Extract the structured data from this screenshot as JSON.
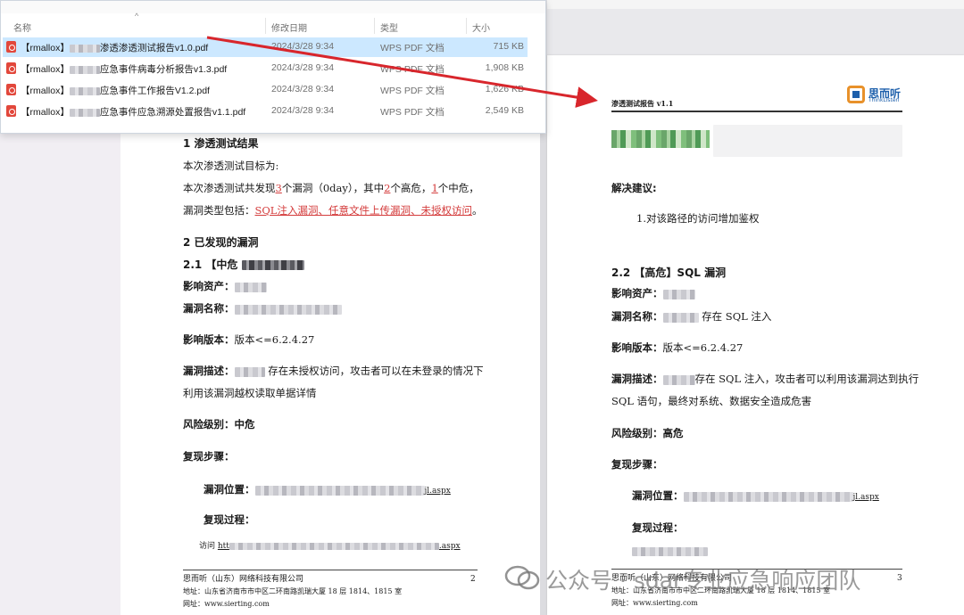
{
  "explorer": {
    "columns": {
      "name": "名称",
      "modified": "修改日期",
      "type": "类型",
      "size": "大小"
    },
    "rows": [
      {
        "prefix": "【rmallox】",
        "name": "渗透渗透测试报告v1.0.pdf",
        "date": "2024/3/28 9:34",
        "type": "WPS PDF 文档",
        "size": "715 KB"
      },
      {
        "prefix": "【rmallox】",
        "name": "应急事件病毒分析报告v1.3.pdf",
        "date": "2024/3/28 9:34",
        "type": "WPS PDF 文档",
        "size": "1,908 KB"
      },
      {
        "prefix": "【rmallox】",
        "name": "应急事件工作报告V1.2.pdf",
        "date": "2024/3/28 9:34",
        "type": "WPS PDF 文档",
        "size": "1,626 KB"
      },
      {
        "prefix": "【rmallox】",
        "name": "应急事件应急溯源处置报告v1.1.pdf",
        "date": "2024/3/28 9:34",
        "type": "WPS PDF 文档",
        "size": "2,549 KB"
      }
    ]
  },
  "left_page": {
    "s1_title": "1 渗透测试结果",
    "s1_line1": "本次渗透测试目标为:",
    "s1_line2_a": "本次渗透测试共发现",
    "s1_line2_n1": "3",
    "s1_line2_b": "个漏洞（0day），其中",
    "s1_line2_n2": "2",
    "s1_line2_c": "个高危，",
    "s1_line2_n3": "1",
    "s1_line2_d": "个中危，",
    "s1_line3_a": "漏洞类型包括：",
    "s1_line3_types": "SQL注入漏洞、任意文件上传漏洞、未授权访问",
    "s1_line3_end": "。",
    "s2_title": "2 已发现的漏洞",
    "s21_title": "2.1 【中危",
    "asset_label": "影响资产：",
    "vuln_name_label": "漏洞名称：",
    "version_label": "影响版本：",
    "version_value": "版本<=6.2.4.27",
    "desc_label": "漏洞描述：",
    "desc_value": "存在未授权访问，攻击者可以在未登录的情况下",
    "desc_value2": "利用该漏洞越权读取单据详情",
    "risk_label": "风险级别：",
    "risk_value": "中危",
    "repro_label": "复现步骤：",
    "location_label": "漏洞位置：",
    "location_tail": "jl.aspx",
    "process_label": "复现过程：",
    "visit_label": "访问",
    "visit_prefix": "htt",
    "visit_tail": ".aspx",
    "footer_company": "思而听（山东）网络科技有限公司",
    "footer_page": "2",
    "footer_addr": "地址：山东省济南市市中区二环南路凯瑞大厦 18 层 1814、1815 室",
    "footer_site": "网址：www.sierting.com"
  },
  "right_page": {
    "header_title": "渗透测试报告 v1.1",
    "logo_text": "思而听",
    "logo_sub": "ThinkListen",
    "solution_label": "解决建议:",
    "solution_item": "1.对该路径的访问增加鉴权",
    "s22_title": "2.2 【高危】SQL 漏洞",
    "asset_label": "影响资产：",
    "vuln_name_label": "漏洞名称：",
    "vuln_name_value": "存在 SQL 注入",
    "version_label": "影响版本：",
    "version_value": "版本<=6.2.4.27",
    "desc_label": "漏洞描述：",
    "desc_value": "存在 SQL 注入，攻击者可以利用该漏洞达到执行",
    "desc_value2": "SQL 语句，最终对系统、数据安全造成危害",
    "risk_label": "风险级别：",
    "risk_value": "高危",
    "repro_label": "复现步骤：",
    "location_label": "漏洞位置：",
    "location_tail": "jl.aspx",
    "process_label": "复现过程：",
    "footer_company": "思而听（山东）网络科技有限公司",
    "footer_page": "3",
    "footer_addr": "地址：山东省济南市市中区二环南路凯瑞大厦 18 层 1814、1815 室",
    "footer_site": "网址：www.sierting.com"
  },
  "watermark": {
    "text": "公众号 · sdar专业应急响应团队"
  },
  "colors": {
    "accent_red": "#d43c3c",
    "selection": "#cce8ff",
    "arrow": "#d8262c"
  }
}
